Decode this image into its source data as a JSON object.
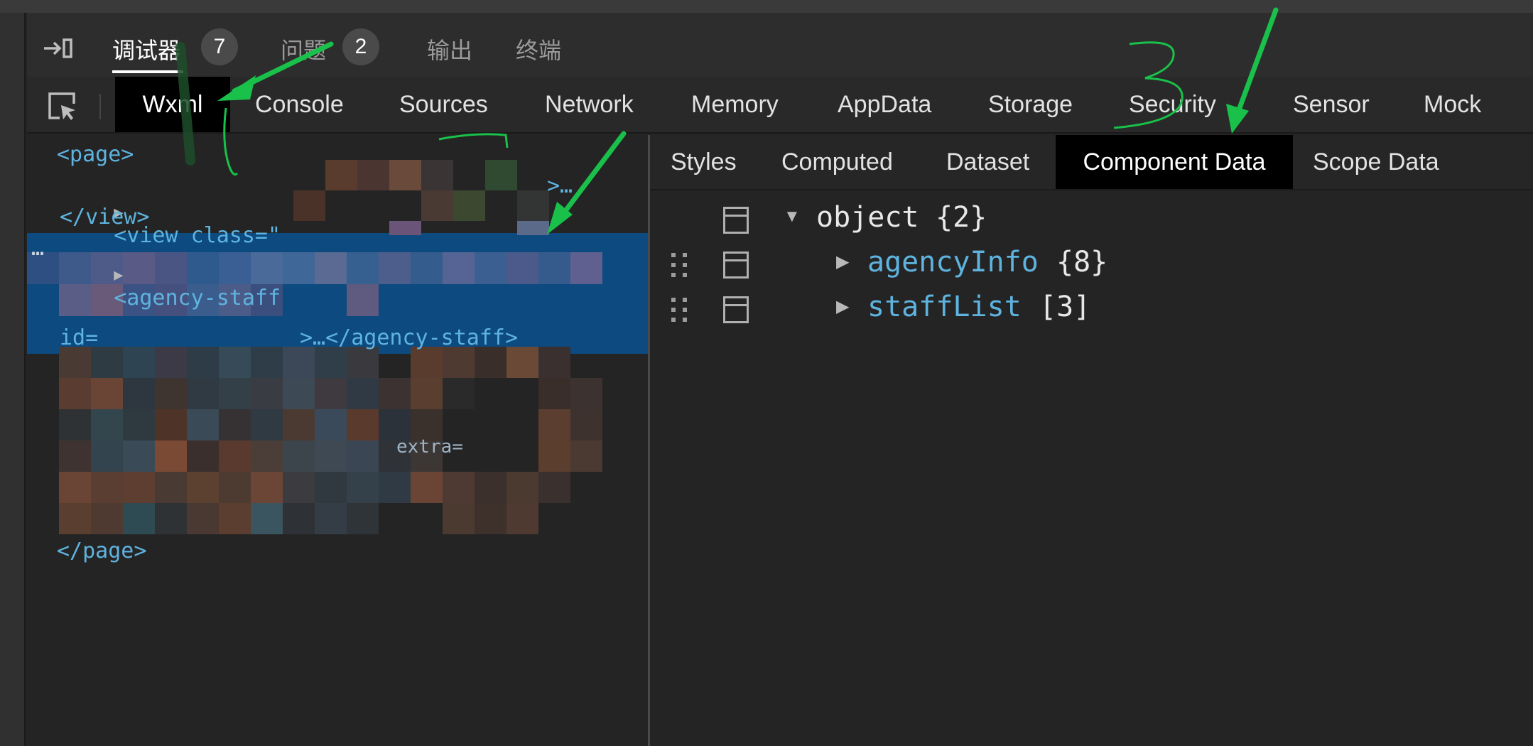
{
  "top_tabs": [
    {
      "label": "调试器",
      "badge": "7",
      "active": true
    },
    {
      "label": "问题",
      "badge": "2",
      "active": false
    },
    {
      "label": "输出",
      "active": false
    },
    {
      "label": "终端",
      "active": false
    }
  ],
  "devtools_tabs": [
    "Wxml",
    "Console",
    "Sources",
    "Network",
    "Memory",
    "AppData",
    "Storage",
    "Security",
    "Sensor",
    "Mock"
  ],
  "active_devtools_tab": "Wxml",
  "wxml": {
    "line_page_open": "<page>",
    "line_view": "<view class=\"",
    "line_view_tail": ">…",
    "line_view_close": "</view>",
    "line_agency_dots": "…",
    "line_agency_open": "<agency-staff",
    "line_agency_id": "id=",
    "line_agency_tail": ">…</agency-staff>",
    "line_extra": "extra=",
    "line_page_close": "</page>"
  },
  "sidebar_tabs": [
    "Styles",
    "Computed",
    "Dataset",
    "Component Data",
    "Scope Data"
  ],
  "active_sidebar_tab": "Component Data",
  "component_data": {
    "root": {
      "key": "object",
      "summary": "{2}"
    },
    "children": [
      {
        "key": "agencyInfo",
        "summary": "{8}"
      },
      {
        "key": "staffList",
        "summary": "[3]"
      }
    ]
  },
  "annotation": {
    "handwritten_number": "3"
  },
  "colors": {
    "accent_blue": "#5eb3df",
    "selection": "#0c4a80",
    "annotation_green": "#19c14a"
  }
}
